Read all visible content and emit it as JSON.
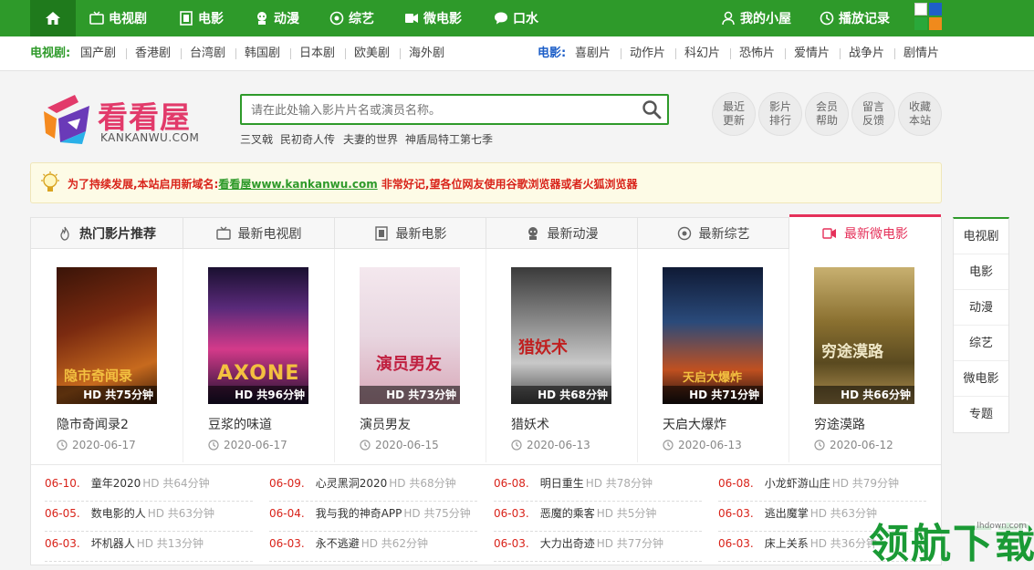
{
  "topnav": {
    "home_icon": "home-icon",
    "items": [
      {
        "label": "电视剧",
        "icon": "tv-icon"
      },
      {
        "label": "电影",
        "icon": "film-icon"
      },
      {
        "label": "动漫",
        "icon": "anime-icon"
      },
      {
        "label": "综艺",
        "icon": "variety-icon"
      },
      {
        "label": "微电影",
        "icon": "micro-film-icon"
      },
      {
        "label": "口水",
        "icon": "chat-icon"
      }
    ],
    "right": [
      {
        "label": "我的小屋",
        "icon": "user-icon"
      },
      {
        "label": "播放记录",
        "icon": "clock-icon"
      }
    ],
    "app_icon": "app-grid-icon",
    "colors": {
      "green": "#2e9a2a",
      "dark_green": "#1f7a1c"
    }
  },
  "subnav": {
    "tv_title": "电视剧:",
    "tv_links": [
      "国产剧",
      "香港剧",
      "台湾剧",
      "韩国剧",
      "日本剧",
      "欧美剧",
      "海外剧"
    ],
    "movie_title": "电影:",
    "movie_links": [
      "喜剧片",
      "动作片",
      "科幻片",
      "恐怖片",
      "爱情片",
      "战争片",
      "剧情片"
    ]
  },
  "logo": {
    "brand": "看看屋",
    "domain": "KANKANWU.COM"
  },
  "search": {
    "placeholder": "请在此处输入影片片名或演员名称。",
    "hot_keywords": [
      "三叉戟",
      "民初奇人传",
      "夫妻的世界",
      "神盾局特工第七季"
    ]
  },
  "quicklinks": [
    [
      "最近",
      "更新"
    ],
    [
      "影片",
      "排行"
    ],
    [
      "会员",
      "帮助"
    ],
    [
      "留言",
      "反馈"
    ],
    [
      "收藏",
      "本站"
    ]
  ],
  "notice": {
    "prefix": "为了持续发展,本站启用新域名:",
    "link": "看看屋www.kankanwu.com",
    "suffix": " 非常好记,望各位网友使用谷歌浏览器或者火狐浏览器"
  },
  "tabs": [
    {
      "label": "热门影片推荐",
      "icon": "fire-icon"
    },
    {
      "label": "最新电视剧",
      "icon": "tv-icon"
    },
    {
      "label": "最新电影",
      "icon": "film-icon"
    },
    {
      "label": "最新动漫",
      "icon": "anime-icon"
    },
    {
      "label": "最新综艺",
      "icon": "variety-icon"
    },
    {
      "label": "最新微电影",
      "icon": "micro-film-icon"
    }
  ],
  "cards": [
    {
      "title": "隐市奇闻录2",
      "badge": "HD 共75分钟",
      "date": "2020-06-17",
      "poster_text": "隐市奇闻录",
      "colors": [
        "#7a2a10",
        "#c76a1e"
      ]
    },
    {
      "title": "豆浆的味道",
      "badge": "HD 共96分钟",
      "date": "2020-06-17",
      "poster_text": "AXONE",
      "colors": [
        "#2a1a4a",
        "#d43a8a"
      ]
    },
    {
      "title": "演员男友",
      "badge": "HD 共73分钟",
      "date": "2020-06-15",
      "poster_text": "演员男友",
      "colors": [
        "#e8d6e0",
        "#c04060"
      ]
    },
    {
      "title": "猎妖术",
      "badge": "HD 共68分钟",
      "date": "2020-06-13",
      "poster_text": "猎妖术",
      "colors": [
        "#5a5a5a",
        "#b8b8b8"
      ]
    },
    {
      "title": "天启大爆炸",
      "badge": "HD 共71分钟",
      "date": "2020-06-13",
      "poster_text": "天启大爆炸",
      "colors": [
        "#1a2a4a",
        "#c05020"
      ]
    },
    {
      "title": "穷途漠路",
      "badge": "HD 共66分钟",
      "date": "2020-06-12",
      "poster_text": "穷途漠路",
      "colors": [
        "#5a4a20",
        "#b09050"
      ]
    }
  ],
  "list": [
    {
      "date": "06-10.",
      "title": "童年2020",
      "quality": "HD 共64分钟"
    },
    {
      "date": "06-09.",
      "title": "心灵黑洞2020",
      "quality": "HD 共68分钟"
    },
    {
      "date": "06-08.",
      "title": "明日重生",
      "quality": "HD 共78分钟"
    },
    {
      "date": "06-08.",
      "title": "小龙虾游山庄",
      "quality": "HD 共79分钟"
    },
    {
      "date": "06-05.",
      "title": "数电影的人",
      "quality": "HD 共63分钟"
    },
    {
      "date": "06-04.",
      "title": "我与我的神奇APP",
      "quality": "HD 共75分钟"
    },
    {
      "date": "06-03.",
      "title": "恶魔的乘客",
      "quality": "HD 共5分钟"
    },
    {
      "date": "06-03.",
      "title": "逃出魔掌",
      "quality": "HD 共63分钟"
    },
    {
      "date": "06-03.",
      "title": "坏机器人",
      "quality": "HD 共13分钟"
    },
    {
      "date": "06-03.",
      "title": "永不逃避",
      "quality": "HD 共62分钟"
    },
    {
      "date": "06-03.",
      "title": "大力出奇迹",
      "quality": "HD 共77分钟"
    },
    {
      "date": "06-03.",
      "title": "床上关系",
      "quality": "HD 共36分钟"
    }
  ],
  "sidenav": [
    "电视剧",
    "电影",
    "动漫",
    "综艺",
    "微电影",
    "专题"
  ],
  "watermark": {
    "big": "领航下载",
    "small": "lhdown.com"
  }
}
